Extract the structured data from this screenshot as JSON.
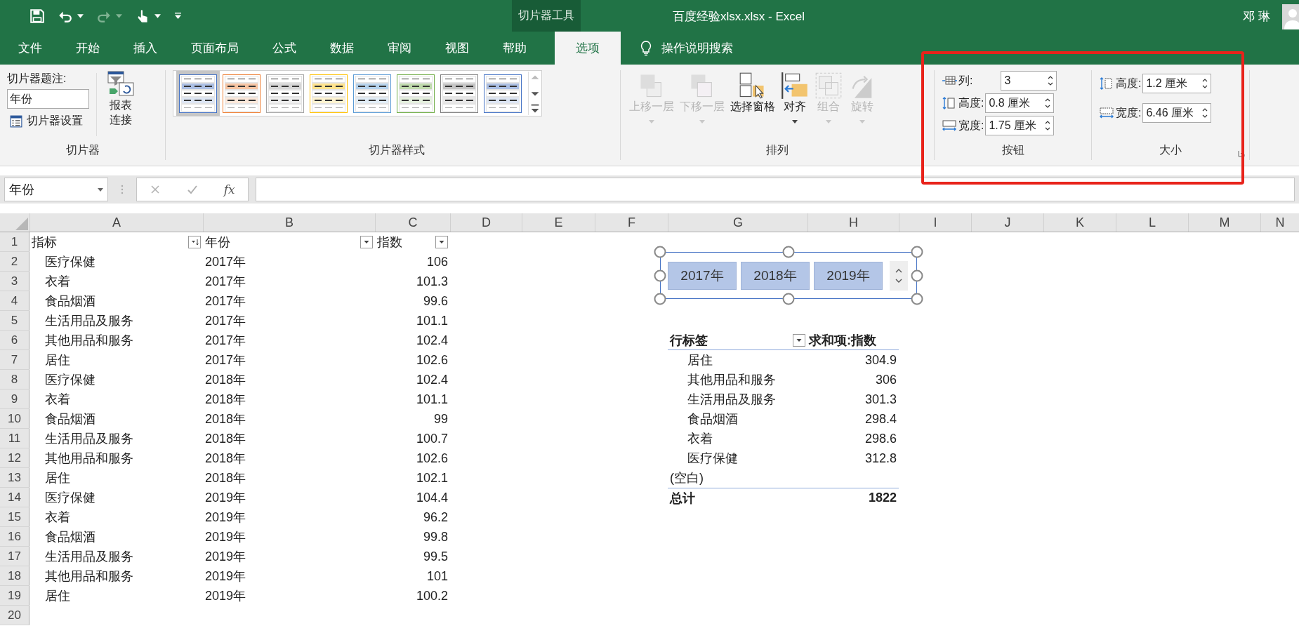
{
  "window": {
    "title": "百度经验xlsx.xlsx  -  Excel",
    "context_label": "切片器工具",
    "user": "邓 琳"
  },
  "tabs": [
    {
      "label": "文件",
      "selected": false
    },
    {
      "label": "开始",
      "selected": false
    },
    {
      "label": "插入",
      "selected": false
    },
    {
      "label": "页面布局",
      "selected": false
    },
    {
      "label": "公式",
      "selected": false
    },
    {
      "label": "数据",
      "selected": false
    },
    {
      "label": "审阅",
      "selected": false
    },
    {
      "label": "视图",
      "selected": false
    },
    {
      "label": "帮助",
      "selected": false
    },
    {
      "label": "选项",
      "selected": true
    }
  ],
  "tell_me": "操作说明搜索",
  "ribbon": {
    "slicer_group": {
      "caption_label": "切片器题注:",
      "caption_value": "年份",
      "settings_button": "切片器设置",
      "connections_button": "报表连接",
      "label": "切片器"
    },
    "styles_group": {
      "label": "切片器样式",
      "styles": [
        {
          "color": "#4472c4",
          "selected": true
        },
        {
          "color": "#ed7d31",
          "selected": false
        },
        {
          "color": "#a5a5a5",
          "selected": false
        },
        {
          "color": "#ffc000",
          "selected": false
        },
        {
          "color": "#5b9bd5",
          "selected": false
        },
        {
          "color": "#70ad47",
          "selected": false
        },
        {
          "color": "#7f7f7f",
          "selected": false
        },
        {
          "color": "#4472c4",
          "selected": false
        }
      ]
    },
    "arrange_group": {
      "label": "排列",
      "buttons": [
        {
          "kind": "forward",
          "label": "上移一层",
          "disabled": true,
          "dropdown": true
        },
        {
          "kind": "backward",
          "label": "下移一层",
          "disabled": true,
          "dropdown": true
        },
        {
          "kind": "pane",
          "label": "选择窗格",
          "disabled": false,
          "dropdown": false
        },
        {
          "kind": "align",
          "label": "对齐",
          "disabled": false,
          "dropdown": true
        },
        {
          "kind": "group",
          "label": "组合",
          "disabled": true,
          "dropdown": true
        },
        {
          "kind": "rotate",
          "label": "旋转",
          "disabled": true,
          "dropdown": true
        }
      ]
    },
    "buttons_group": {
      "label": "按钮",
      "fields": [
        {
          "kind": "columns",
          "label": "列:",
          "value": "3"
        },
        {
          "kind": "height",
          "label": "高度:",
          "value": "0.8 厘米"
        },
        {
          "kind": "width",
          "label": "宽度:",
          "value": "1.75 厘米"
        }
      ]
    },
    "size_group": {
      "label": "大小",
      "fields": [
        {
          "kind": "height",
          "label": "高度:",
          "value": "1.2 厘米"
        },
        {
          "kind": "width",
          "label": "宽度:",
          "value": "6.46 厘米"
        }
      ]
    }
  },
  "formula_bar": {
    "name_box": "年份",
    "fx": "fx"
  },
  "sheet": {
    "columns": [
      "A",
      "B",
      "C",
      "D",
      "E",
      "F",
      "G",
      "H",
      "I",
      "J",
      "K",
      "L",
      "M",
      "N"
    ],
    "row_numbers": [
      "1",
      "2",
      "3",
      "4",
      "5",
      "6",
      "7",
      "8",
      "9",
      "10",
      "11",
      "12",
      "13",
      "14",
      "15",
      "16",
      "17",
      "18",
      "19",
      "20"
    ],
    "header": {
      "a": "指标",
      "b": "年份",
      "c": "指数"
    },
    "rows": [
      {
        "a": "医疗保健",
        "b": "2017年",
        "c": "106"
      },
      {
        "a": "衣着",
        "b": "2017年",
        "c": "101.3"
      },
      {
        "a": "食品烟酒",
        "b": "2017年",
        "c": "99.6"
      },
      {
        "a": "生活用品及服务",
        "b": "2017年",
        "c": "101.1"
      },
      {
        "a": "其他用品和服务",
        "b": "2017年",
        "c": "102.4"
      },
      {
        "a": "居住",
        "b": "2017年",
        "c": "102.6"
      },
      {
        "a": "医疗保健",
        "b": "2018年",
        "c": "102.4"
      },
      {
        "a": "衣着",
        "b": "2018年",
        "c": "101.1"
      },
      {
        "a": "食品烟酒",
        "b": "2018年",
        "c": "99"
      },
      {
        "a": "生活用品及服务",
        "b": "2018年",
        "c": "100.7"
      },
      {
        "a": "其他用品和服务",
        "b": "2018年",
        "c": "102.6"
      },
      {
        "a": "居住",
        "b": "2018年",
        "c": "102.1"
      },
      {
        "a": "医疗保健",
        "b": "2019年",
        "c": "104.4"
      },
      {
        "a": "衣着",
        "b": "2019年",
        "c": "96.2"
      },
      {
        "a": "食品烟酒",
        "b": "2019年",
        "c": "99.8"
      },
      {
        "a": "生活用品及服务",
        "b": "2019年",
        "c": "99.5"
      },
      {
        "a": "其他用品和服务",
        "b": "2019年",
        "c": "101"
      },
      {
        "a": "居住",
        "b": "2019年",
        "c": "100.2"
      }
    ]
  },
  "slicer": {
    "items": [
      {
        "label": "2017年",
        "selected": true
      },
      {
        "label": "2018年",
        "selected": true
      },
      {
        "label": "2019年",
        "selected": true
      }
    ]
  },
  "pivot_table": {
    "header": {
      "row_label": "行标签",
      "value_label": "求和项:指数"
    },
    "rows": [
      {
        "kind": "item",
        "label": "居住",
        "value": "304.9"
      },
      {
        "kind": "item",
        "label": "其他用品和服务",
        "value": "306"
      },
      {
        "kind": "item",
        "label": "生活用品及服务",
        "value": "301.3"
      },
      {
        "kind": "item",
        "label": "食品烟酒",
        "value": "298.4"
      },
      {
        "kind": "item",
        "label": "衣着",
        "value": "298.6"
      },
      {
        "kind": "item",
        "label": "医疗保健",
        "value": "312.8"
      },
      {
        "kind": "blank",
        "label": "(空白)"
      }
    ],
    "total": {
      "label": "总计",
      "value": "1822"
    }
  }
}
